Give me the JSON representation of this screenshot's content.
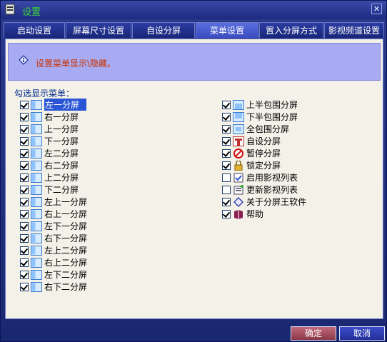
{
  "window": {
    "title": "设置",
    "close_glyph": "✕"
  },
  "tabs": [
    {
      "label": "启动设置"
    },
    {
      "label": "屏幕尺寸设置"
    },
    {
      "label": "自设分屏"
    },
    {
      "label": "菜单设置"
    },
    {
      "label": "置入分屏方式"
    },
    {
      "label": "影视频道设置"
    }
  ],
  "info": {
    "text": "设置菜单显示\\隐藏。"
  },
  "section_label": "勾选显示菜单：",
  "left_items": [
    {
      "label": "左一分屏",
      "checked": true
    },
    {
      "label": "右一分屏",
      "checked": true
    },
    {
      "label": "上一分屏",
      "checked": true
    },
    {
      "label": "下一分屏",
      "checked": true
    },
    {
      "label": "左二分屏",
      "checked": true
    },
    {
      "label": "右二分屏",
      "checked": true
    },
    {
      "label": "上二分屏",
      "checked": true
    },
    {
      "label": "下二分屏",
      "checked": true
    },
    {
      "label": "左上一分屏",
      "checked": true
    },
    {
      "label": "右上一分屏",
      "checked": true
    },
    {
      "label": "左下一分屏",
      "checked": true
    },
    {
      "label": "右下一分屏",
      "checked": true
    },
    {
      "label": "左上二分屏",
      "checked": true
    },
    {
      "label": "右上二分屏",
      "checked": true
    },
    {
      "label": "左下二分屏",
      "checked": true
    },
    {
      "label": "右下二分屏",
      "checked": true
    }
  ],
  "right_items": [
    {
      "label": "上半包围分屏",
      "checked": true
    },
    {
      "label": "下半包围分屏",
      "checked": true
    },
    {
      "label": "全包围分屏",
      "checked": true
    },
    {
      "label": "自设分屏",
      "checked": true
    },
    {
      "label": "暂停分屏",
      "checked": true
    },
    {
      "label": "锁定分屏",
      "checked": true
    },
    {
      "label": "启用影视列表",
      "checked": false
    },
    {
      "label": "更新影视列表",
      "checked": false
    },
    {
      "label": "关于分屏王软件",
      "checked": true
    },
    {
      "label": "帮助",
      "checked": true
    }
  ],
  "buttons": {
    "ok": "确定",
    "cancel": "取消"
  },
  "colors": {
    "accent": "#2a56d6",
    "info_text": "#c83200",
    "title_text": "#3cd63c"
  }
}
